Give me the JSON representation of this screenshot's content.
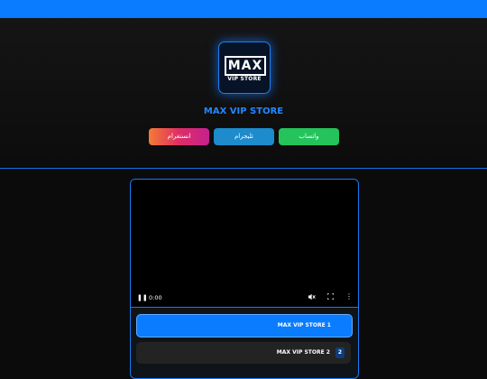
{
  "brand": {
    "logo_main": "MAX",
    "logo_sub": "VIP STORE",
    "name": "MAX VIP STORE"
  },
  "social": {
    "instagram": "انستغرام",
    "telegram": "تليجرام",
    "whatsapp": "واتساب"
  },
  "video": {
    "time": "0:00",
    "pause_icon": "pause-icon",
    "mute_icon": "mute-icon",
    "fullscreen_icon": "fullscreen-icon",
    "more_icon": "more-vertical-icon"
  },
  "playlist": [
    {
      "label": "MAX VIP STORE 1",
      "active": true
    },
    {
      "label": "MAX VIP STORE 2",
      "num": "2",
      "active": false
    }
  ],
  "colors": {
    "accent": "#0a7cff",
    "telegram": "#1d8bcc",
    "whatsapp": "#25c35c"
  }
}
